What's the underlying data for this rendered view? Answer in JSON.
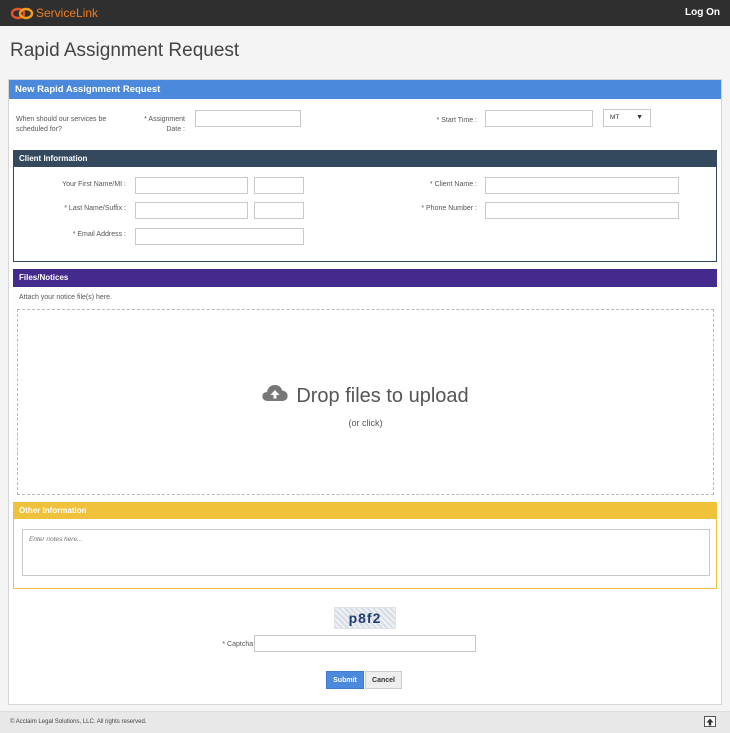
{
  "header": {
    "brand": "ServiceLink",
    "login_label": "Log On"
  },
  "page": {
    "title": "Rapid Assignment Request"
  },
  "sections": {
    "main_title": "New Rapid Assignment Request",
    "client_title": "Client Information",
    "files_title": "Files/Notices",
    "other_title": "Other Information"
  },
  "schedule": {
    "question": "When should our services be scheduled for?",
    "assignment_date_label": "* Assignment Date :",
    "assignment_date_value": "",
    "start_time_label": "* Start Time :",
    "start_time_value": "",
    "timezone_selected": "MT"
  },
  "client": {
    "first_name_label": "Your First Name/MI :",
    "last_name_label": "* Last Name/Suffix :",
    "email_label": "* Email Address :",
    "client_name_label": "* Client Name :",
    "phone_label": "* Phone Number :"
  },
  "files": {
    "instructions": "Attach your notice file(s) here.",
    "drop_text": "Drop files to upload",
    "drop_sub": "(or click)"
  },
  "other": {
    "notes_placeholder": "Enter notes here..."
  },
  "captcha": {
    "image_text": "p8f2",
    "label": "* Captcha :"
  },
  "actions": {
    "submit_label": "Submit",
    "cancel_label": "Cancel"
  },
  "footer": {
    "copyright": "© Acclaim Legal Solutions, LLC. All rights reserved."
  },
  "colors": {
    "topbar": "#2f2f2f",
    "brand": "#f07c20",
    "main_header": "#4a89dc",
    "client_header": "#34495e",
    "files_header": "#452a8e",
    "other_header": "#f0c23c"
  }
}
